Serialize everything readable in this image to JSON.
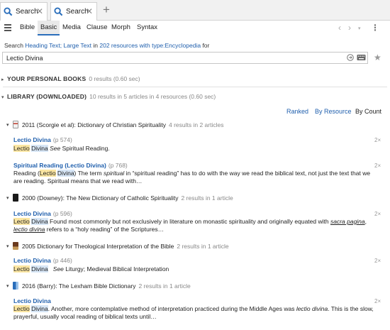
{
  "tabs": [
    {
      "label": "Search",
      "close": "✕"
    },
    {
      "label": "Search",
      "close": "✕"
    }
  ],
  "new_tab": "+",
  "menu_tabs": [
    "Bible",
    "Basic",
    "Media",
    "Clause",
    "Morph",
    "Syntax"
  ],
  "active_menu_tab": "Basic",
  "search_desc": {
    "prefix": "Search ",
    "fields": "Heading Text; Large Text",
    "in": " in ",
    "resources": "202 resources with type:Encyclopedia",
    "suffix": " for"
  },
  "query": "Lectio Divina",
  "sections": {
    "personal": {
      "title": "YOUR PERSONAL BOOKS",
      "meta": "0 results (0.60 sec)"
    },
    "library": {
      "title": "LIBRARY (DOWNLOADED)",
      "meta": "10 results in 5 articles in 4 resources (0.60 sec)"
    }
  },
  "sort_options": [
    "Ranked",
    "By Resource",
    "By Count"
  ],
  "resources": [
    {
      "title": "2011 (Scorgie et al): Dictionary of Christian Spirituality",
      "meta": "4 results in 2 articles",
      "hits": [
        {
          "head": "Lectio Divina",
          "page": "(p 574)",
          "count": "2×",
          "snip": {
            "w1": "Lectio",
            "w2": "Divina",
            "rest": "See",
            "ref": "Spiritual Reading."
          }
        },
        {
          "head": "Spiritual Reading (Lectio Divina)",
          "page": "(p 768)",
          "count": "2×",
          "snip": {
            "a": "Reading (",
            "w1": "Lectio",
            "w2": "Divina",
            "b": ") The term ",
            "c": "spiritual",
            "d": " in “spiritual reading” has to do with the way we read the biblical text, not just the text that we are reading. Spiritual means that we read with…"
          }
        }
      ]
    },
    {
      "title": "2000 (Downey): The New Dictionary of Catholic Spirituality",
      "meta": "2 results in 1 article",
      "hits": [
        {
          "head": "Lectio Divina",
          "page": "(p 596)",
          "count": "2×",
          "snip": {
            "w1": "Lectio",
            "w2": "Divina",
            "a": " Found most commonly but not exclusively in literature on monastic spirituality and originally equated with ",
            "u1": "sacra pagina",
            "b": ", ",
            "u2": "lectio divina",
            "c": " refers to a “holy reading” of the Scriptures…"
          }
        }
      ]
    },
    {
      "title": "2005 Dictionary for Theological Interpretation of the Bible",
      "meta": "2 results in 1 article",
      "hits": [
        {
          "head": "Lectio Divina",
          "page": "(p 446)",
          "count": "2×",
          "snip": {
            "w1": "Lectio",
            "w2": "Divina",
            "rest": "See",
            "ref": "Liturgy; Medieval Biblical Interpretation"
          }
        }
      ]
    },
    {
      "title": "2016 (Barry): The Lexham Bible Dictionary",
      "meta": "2 results in 1 article",
      "hits": [
        {
          "head": "Lectio Divina",
          "page": "",
          "count": "2×",
          "snip": {
            "w1": "Lectio",
            "w2": "Divina",
            "a": ". Another, more contemplative method of interpretation practiced during the Middle Ages was ",
            "i": "lectio divina",
            "b": ". This is the slow, prayerful, usually vocal reading of biblical texts until…"
          }
        }
      ]
    }
  ],
  "colors": {
    "link": "#1f5fad",
    "highlight": "#fbe6a2",
    "highlight2": "#d7e6f6",
    "active_tab_underline": "#2a6ebb"
  }
}
